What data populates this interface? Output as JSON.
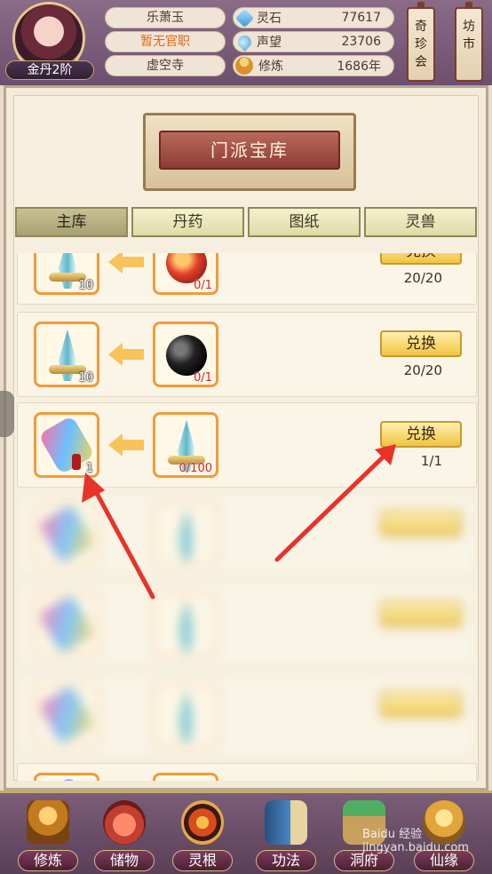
{
  "player": {
    "rank": "金丹2阶",
    "name": "乐萧玉",
    "official_title": "暂无官职",
    "sect": "虚空寺"
  },
  "stats": [
    {
      "icon": "spirit-stone-icon",
      "label": "灵石",
      "value": "77617"
    },
    {
      "icon": "prestige-icon",
      "label": "声望",
      "value": "23706"
    },
    {
      "icon": "cultivation-icon",
      "label": "修炼",
      "value": "1686年"
    }
  ],
  "hang_buttons": [
    {
      "label": "奇珍会"
    },
    {
      "label": "坊市"
    }
  ],
  "panel": {
    "title": "门派宝库",
    "tabs": [
      "主库",
      "丹药",
      "图纸",
      "灵兽"
    ],
    "active_tab": 0
  },
  "rows": [
    {
      "target_count": "10",
      "cost_count": "0/1",
      "button": "兑换",
      "stock": "20/20"
    },
    {
      "target_count": "10",
      "cost_count": "0/1",
      "button": "兑换",
      "stock": "20/20"
    },
    {
      "target_count": "1",
      "cost_count": "0/100",
      "button": "兑换",
      "stock": "1/1"
    }
  ],
  "bottom_nav": [
    {
      "label": "修炼",
      "icon": "cultivate-icon"
    },
    {
      "label": "储物",
      "icon": "storage-bag-icon"
    },
    {
      "label": "灵根",
      "icon": "spirit-root-icon"
    },
    {
      "label": "功法",
      "icon": "technique-book-icon"
    },
    {
      "label": "洞府",
      "icon": "cave-mansion-icon"
    },
    {
      "label": "仙缘",
      "icon": "fate-gourd-icon"
    }
  ],
  "watermark": "Baidu 经验 jingyan.baidu.com",
  "colors": {
    "accent_orange": "#f29a3a",
    "button_gold": "#f0c441",
    "annotation_red": "#e8322a"
  }
}
